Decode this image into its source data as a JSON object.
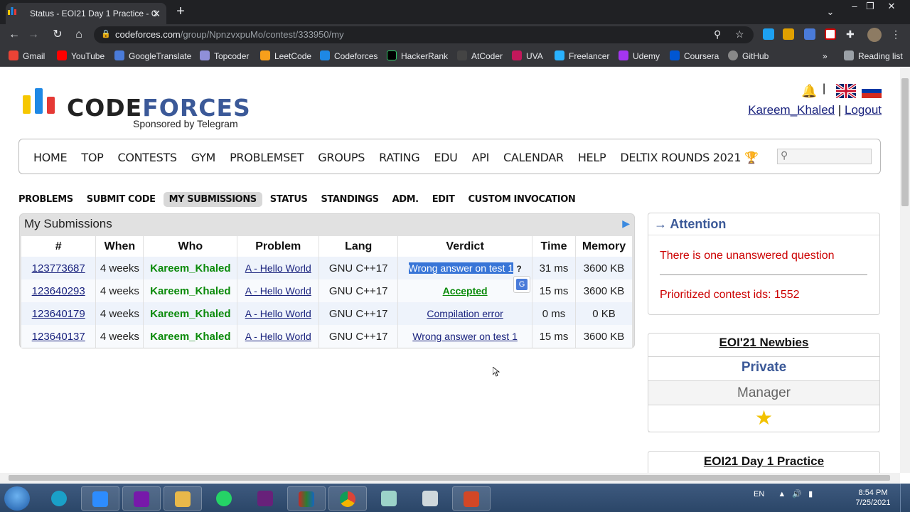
{
  "browser": {
    "tab_title": "Status - EOI21 Day 1 Practice - C",
    "tab_close": "✕",
    "new_tab": "+",
    "url_host": "codeforces.com",
    "url_path": "/group/NpnzvxpuMo/contest/333950/my",
    "bookmarks": [
      "Gmail",
      "YouTube",
      "GoogleTranslate",
      "Topcoder",
      "LeetCode",
      "Codeforces",
      "HackerRank",
      "AtCoder",
      "UVA",
      "Freelancer",
      "Udemy",
      "Coursera",
      "GitHub"
    ],
    "bookmark_more": "»",
    "reading_list": "Reading list",
    "icons": {
      "back": "back-icon",
      "forward": "forward-icon",
      "reload": "reload-icon",
      "home": "home-icon"
    }
  },
  "header": {
    "logo_text": "CODEFORCES",
    "logo_sub": "Sponsored by Telegram",
    "user": "Kareem_Khaled",
    "sep": "|",
    "logout": "Logout"
  },
  "menu": [
    "HOME",
    "TOP",
    "CONTESTS",
    "GYM",
    "PROBLEMSET",
    "GROUPS",
    "RATING",
    "EDU",
    "API",
    "CALENDAR",
    "HELP",
    "DELTIX ROUNDS 2021 🏆"
  ],
  "subtabs": [
    "PROBLEMS",
    "SUBMIT CODE",
    "MY SUBMISSIONS",
    "STATUS",
    "STANDINGS",
    "ADM.",
    "EDIT",
    "CUSTOM INVOCATION"
  ],
  "submissions": {
    "title": "My Submissions",
    "columns": [
      "#",
      "When",
      "Who",
      "Problem",
      "Lang",
      "Verdict",
      "Time",
      "Memory"
    ],
    "rows": [
      {
        "id": "123773687",
        "when": "4 weeks",
        "who": "Kareem_Khaled",
        "problem": "A - Hello World",
        "lang": "GNU C++17",
        "verdict": "Wrong answer on test 1",
        "time": "31 ms",
        "memory": "3600 KB"
      },
      {
        "id": "123640293",
        "when": "4 weeks",
        "who": "Kareem_Khaled",
        "problem": "A - Hello World",
        "lang": "GNU C++17",
        "verdict": "Accepted",
        "time": "15 ms",
        "memory": "3600 KB"
      },
      {
        "id": "123640179",
        "when": "4 weeks",
        "who": "Kareem_Khaled",
        "problem": "A - Hello World",
        "lang": "GNU C++17",
        "verdict": "Compilation error",
        "time": "0 ms",
        "memory": "0 KB"
      },
      {
        "id": "123640137",
        "when": "4 weeks",
        "who": "Kareem_Khaled",
        "problem": "A - Hello World",
        "lang": "GNU C++17",
        "verdict": "Wrong answer on test 1",
        "time": "15 ms",
        "memory": "3600 KB"
      }
    ]
  },
  "attention": {
    "title": "→ Attention",
    "question": "There is one unanswered question",
    "ids": "Prioritized contest ids: 1552"
  },
  "group": {
    "name": "EOI'21 Newbies",
    "privacy": "Private",
    "role": "Manager"
  },
  "contest_box": {
    "name": "EOI21 Day 1 Practice"
  },
  "taskbar": {
    "lang": "EN",
    "time": "8:54 PM",
    "date": "7/25/2021"
  },
  "colors": {
    "codeforces_blue": "#1a237e",
    "verdict_green": "#0a8a0a",
    "attention_red": "#cc0000",
    "selection": "#3875d7"
  }
}
